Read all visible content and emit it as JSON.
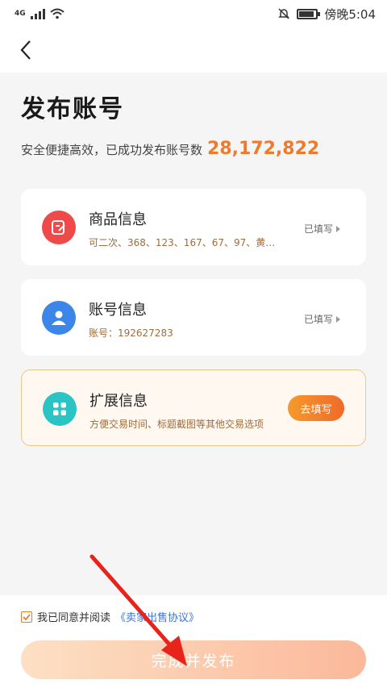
{
  "status_bar": {
    "network": "4G",
    "time": "傍晚5:04"
  },
  "header": {
    "back_icon": "chevron-left-icon"
  },
  "page": {
    "title": "发布账号",
    "subtitle": "安全便捷高效，已成功发布账号数",
    "count": "28,172,822"
  },
  "cards": [
    {
      "title": "商品信息",
      "subtitle": "可二次、368、123、167、67、97、黄…",
      "status": "已填写",
      "icon": "edit-icon",
      "color": "#ef4a4a"
    },
    {
      "title": "账号信息",
      "subtitle": "账号：192627283",
      "status": "已填写",
      "icon": "user-icon",
      "color": "#3b86e8"
    },
    {
      "title": "扩展信息",
      "subtitle": "方便交易时间、标题截图等其他交易选项",
      "button": "去填写",
      "icon": "grid-icon",
      "color": "#2bc4c4"
    }
  ],
  "footer": {
    "agree_text": "我已同意并阅读",
    "agreement_link": "《卖家出售协议》",
    "submit_label": "完成并发布",
    "accent": "#f07a2a"
  }
}
